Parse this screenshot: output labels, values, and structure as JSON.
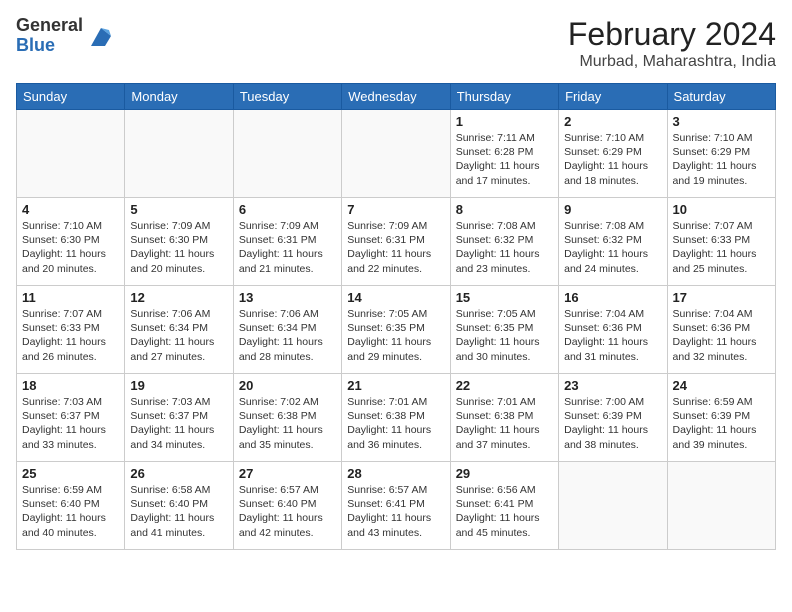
{
  "logo": {
    "general": "General",
    "blue": "Blue"
  },
  "title": {
    "month": "February 2024",
    "location": "Murbad, Maharashtra, India"
  },
  "weekdays": [
    "Sunday",
    "Monday",
    "Tuesday",
    "Wednesday",
    "Thursday",
    "Friday",
    "Saturday"
  ],
  "weeks": [
    [
      {
        "day": null,
        "info": null
      },
      {
        "day": null,
        "info": null
      },
      {
        "day": null,
        "info": null
      },
      {
        "day": null,
        "info": null
      },
      {
        "day": "1",
        "info": "Sunrise: 7:11 AM\nSunset: 6:28 PM\nDaylight: 11 hours and 17 minutes."
      },
      {
        "day": "2",
        "info": "Sunrise: 7:10 AM\nSunset: 6:29 PM\nDaylight: 11 hours and 18 minutes."
      },
      {
        "day": "3",
        "info": "Sunrise: 7:10 AM\nSunset: 6:29 PM\nDaylight: 11 hours and 19 minutes."
      }
    ],
    [
      {
        "day": "4",
        "info": "Sunrise: 7:10 AM\nSunset: 6:30 PM\nDaylight: 11 hours and 20 minutes."
      },
      {
        "day": "5",
        "info": "Sunrise: 7:09 AM\nSunset: 6:30 PM\nDaylight: 11 hours and 20 minutes."
      },
      {
        "day": "6",
        "info": "Sunrise: 7:09 AM\nSunset: 6:31 PM\nDaylight: 11 hours and 21 minutes."
      },
      {
        "day": "7",
        "info": "Sunrise: 7:09 AM\nSunset: 6:31 PM\nDaylight: 11 hours and 22 minutes."
      },
      {
        "day": "8",
        "info": "Sunrise: 7:08 AM\nSunset: 6:32 PM\nDaylight: 11 hours and 23 minutes."
      },
      {
        "day": "9",
        "info": "Sunrise: 7:08 AM\nSunset: 6:32 PM\nDaylight: 11 hours and 24 minutes."
      },
      {
        "day": "10",
        "info": "Sunrise: 7:07 AM\nSunset: 6:33 PM\nDaylight: 11 hours and 25 minutes."
      }
    ],
    [
      {
        "day": "11",
        "info": "Sunrise: 7:07 AM\nSunset: 6:33 PM\nDaylight: 11 hours and 26 minutes."
      },
      {
        "day": "12",
        "info": "Sunrise: 7:06 AM\nSunset: 6:34 PM\nDaylight: 11 hours and 27 minutes."
      },
      {
        "day": "13",
        "info": "Sunrise: 7:06 AM\nSunset: 6:34 PM\nDaylight: 11 hours and 28 minutes."
      },
      {
        "day": "14",
        "info": "Sunrise: 7:05 AM\nSunset: 6:35 PM\nDaylight: 11 hours and 29 minutes."
      },
      {
        "day": "15",
        "info": "Sunrise: 7:05 AM\nSunset: 6:35 PM\nDaylight: 11 hours and 30 minutes."
      },
      {
        "day": "16",
        "info": "Sunrise: 7:04 AM\nSunset: 6:36 PM\nDaylight: 11 hours and 31 minutes."
      },
      {
        "day": "17",
        "info": "Sunrise: 7:04 AM\nSunset: 6:36 PM\nDaylight: 11 hours and 32 minutes."
      }
    ],
    [
      {
        "day": "18",
        "info": "Sunrise: 7:03 AM\nSunset: 6:37 PM\nDaylight: 11 hours and 33 minutes."
      },
      {
        "day": "19",
        "info": "Sunrise: 7:03 AM\nSunset: 6:37 PM\nDaylight: 11 hours and 34 minutes."
      },
      {
        "day": "20",
        "info": "Sunrise: 7:02 AM\nSunset: 6:38 PM\nDaylight: 11 hours and 35 minutes."
      },
      {
        "day": "21",
        "info": "Sunrise: 7:01 AM\nSunset: 6:38 PM\nDaylight: 11 hours and 36 minutes."
      },
      {
        "day": "22",
        "info": "Sunrise: 7:01 AM\nSunset: 6:38 PM\nDaylight: 11 hours and 37 minutes."
      },
      {
        "day": "23",
        "info": "Sunrise: 7:00 AM\nSunset: 6:39 PM\nDaylight: 11 hours and 38 minutes."
      },
      {
        "day": "24",
        "info": "Sunrise: 6:59 AM\nSunset: 6:39 PM\nDaylight: 11 hours and 39 minutes."
      }
    ],
    [
      {
        "day": "25",
        "info": "Sunrise: 6:59 AM\nSunset: 6:40 PM\nDaylight: 11 hours and 40 minutes."
      },
      {
        "day": "26",
        "info": "Sunrise: 6:58 AM\nSunset: 6:40 PM\nDaylight: 11 hours and 41 minutes."
      },
      {
        "day": "27",
        "info": "Sunrise: 6:57 AM\nSunset: 6:40 PM\nDaylight: 11 hours and 42 minutes."
      },
      {
        "day": "28",
        "info": "Sunrise: 6:57 AM\nSunset: 6:41 PM\nDaylight: 11 hours and 43 minutes."
      },
      {
        "day": "29",
        "info": "Sunrise: 6:56 AM\nSunset: 6:41 PM\nDaylight: 11 hours and 45 minutes."
      },
      {
        "day": null,
        "info": null
      },
      {
        "day": null,
        "info": null
      }
    ]
  ]
}
